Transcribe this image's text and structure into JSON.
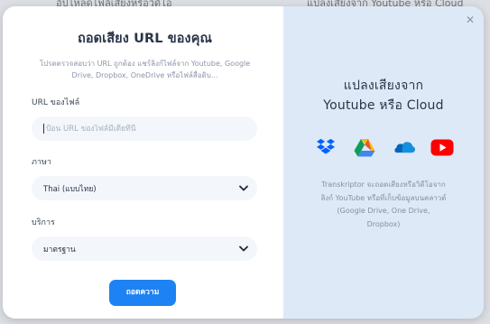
{
  "backdrop": {
    "left_text": "อัปโหลดไฟล์เสียงหรือวิดีโอ",
    "right_text": "แปลงเสียงจาก Youtube หรือ Cloud"
  },
  "modal": {
    "close_symbol": "✕",
    "title": "ถอดเสียง URL ของคุณ",
    "subtitle": "โปรดตรวจสอบว่า URL ถูกต้อง แชร์ลิงก์ไฟล์จาก Youtube, Google Drive, Dropbox, OneDrive หรือไฟล์สื่อดิบ...",
    "url_field": {
      "label": "URL ของไฟล์",
      "placeholder": "ป้อน URL ของไฟล์มีเดียที่นี่",
      "value": ""
    },
    "language_field": {
      "label": "ภาษา",
      "selected": "Thai (แบบไทย)"
    },
    "service_field": {
      "label": "บริการ",
      "selected": "มาตรฐาน"
    },
    "submit_label": "ถอดความ"
  },
  "promo": {
    "title_line1": "แปลงเสียงจาก",
    "title_line2": "Youtube หรือ Cloud",
    "icons": [
      "dropbox-icon",
      "google-drive-icon",
      "onedrive-icon",
      "youtube-icon"
    ],
    "description": "Transkriptor จะถอดเสียงหรือวิดีโอจากลิงก์ YouTube หรือที่เก็บข้อมูลบนคลาวด์ (Google Drive, One Drive, Dropbox)"
  },
  "colors": {
    "accent": "#1d82f3",
    "promo_bg": "#dde9f7",
    "dropbox": "#0061fe",
    "onedrive": "#0364b8",
    "youtube": "#ff0000"
  }
}
